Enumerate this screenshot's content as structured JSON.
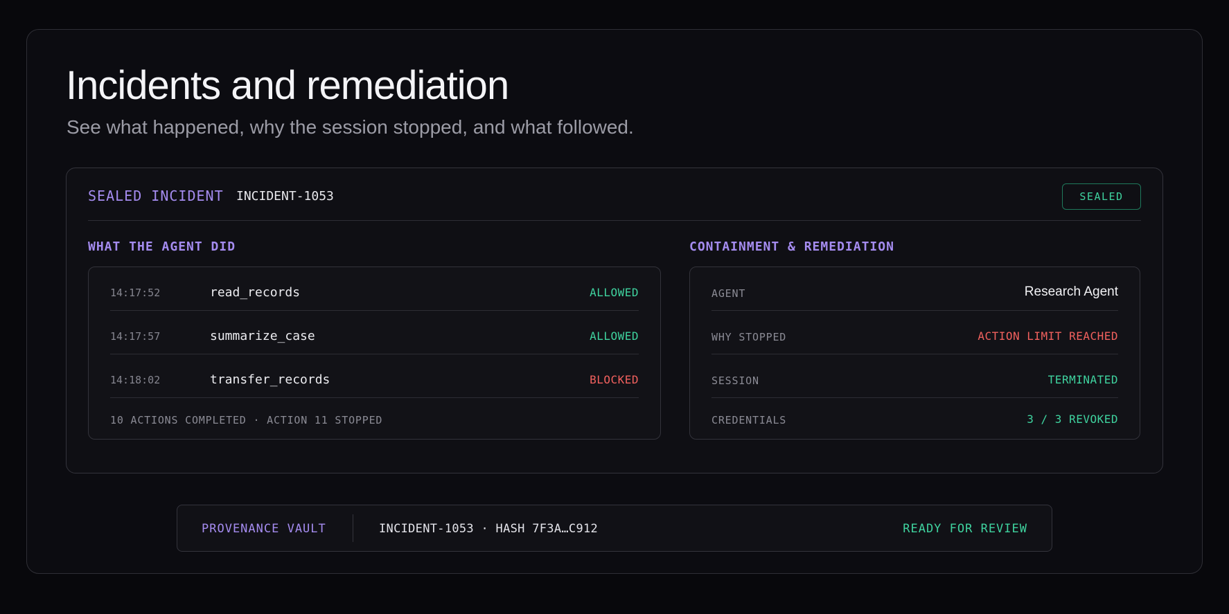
{
  "page": {
    "title": "Incidents and remediation",
    "subtitle": "See what happened, why the session stopped, and what followed."
  },
  "incident": {
    "label": "SEALED INCIDENT",
    "id": "INCIDENT-1053",
    "badge": "SEALED"
  },
  "agent_actions": {
    "heading": "WHAT THE AGENT DID",
    "rows": [
      {
        "time": "14:17:52",
        "action": "read_records",
        "status": "ALLOWED"
      },
      {
        "time": "14:17:57",
        "action": "summarize_case",
        "status": "ALLOWED"
      },
      {
        "time": "14:18:02",
        "action": "transfer_records",
        "status": "BLOCKED"
      }
    ],
    "footer": "10 ACTIONS COMPLETED · ACTION 11 STOPPED"
  },
  "remediation": {
    "heading": "CONTAINMENT & REMEDIATION",
    "rows": [
      {
        "key": "AGENT",
        "value": "Research Agent"
      },
      {
        "key": "WHY STOPPED",
        "value": "ACTION LIMIT REACHED"
      },
      {
        "key": "SESSION",
        "value": "TERMINATED"
      },
      {
        "key": "CREDENTIALS",
        "value": "3 / 3 REVOKED"
      }
    ]
  },
  "vault": {
    "label": "PROVENANCE VAULT",
    "meta": "INCIDENT-1053 · HASH 7F3A…C912",
    "status": "READY FOR REVIEW"
  },
  "colors": {
    "accent_purple": "#a58cf0",
    "status_green": "#3fd39f",
    "status_red": "#f2615e"
  }
}
